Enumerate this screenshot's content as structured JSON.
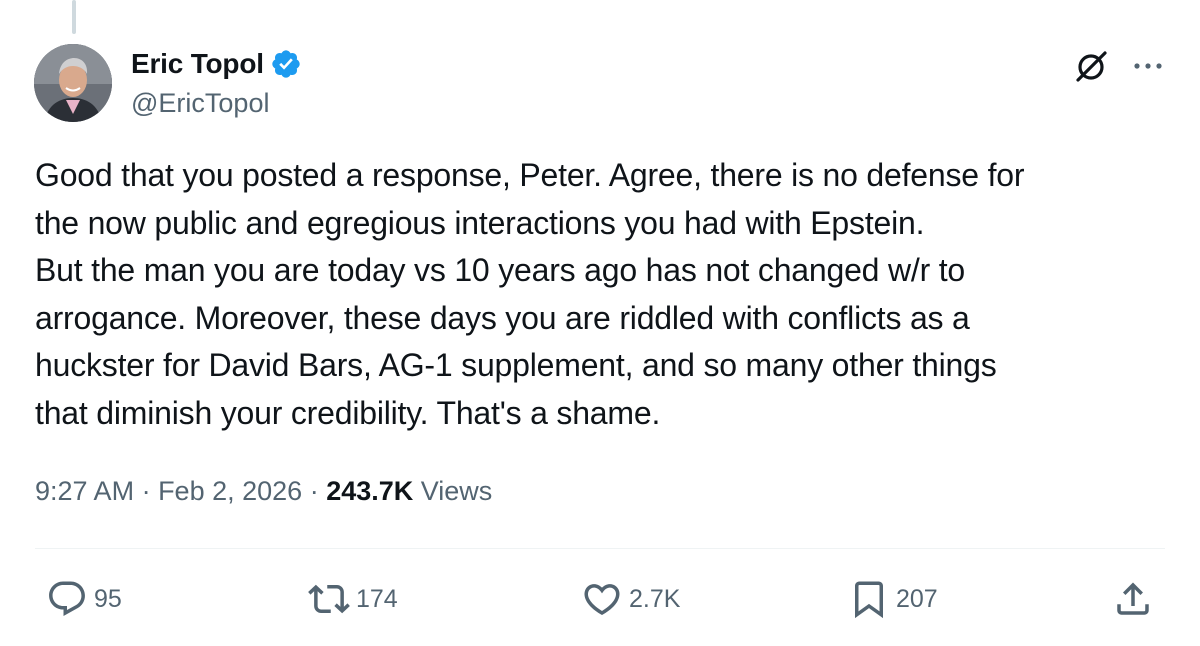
{
  "author": {
    "display_name": "Eric Topol",
    "handle": "@EricTopol",
    "verified": true
  },
  "tweet": {
    "text": "Good that you posted a response, Peter. Agree, there is no defense for\nthe now public and egregious interactions you had with Epstein.\nBut the man you are today vs 10 years ago has not changed w/r to\narrogance. Moreover, these days you are riddled with conflicts as a\nhuckster for David Bars, AG-1 supplement, and so many other things\nthat diminish your credibility. That's a shame."
  },
  "meta": {
    "time": "9:27 AM",
    "separator": " · ",
    "date": "Feb 2, 2026",
    "views_count": "243.7K",
    "views_label": " Views"
  },
  "actions": {
    "replies": "95",
    "reposts": "174",
    "likes": "2.7K",
    "bookmarks": "207"
  },
  "colors": {
    "text_primary": "#0f1419",
    "text_secondary": "#536471",
    "verified_blue": "#1d9bf0",
    "divider": "#eff3f4"
  },
  "icons": [
    "verified-badge-icon",
    "grok-icon",
    "more-icon",
    "reply-icon",
    "repost-icon",
    "like-icon",
    "bookmark-icon",
    "share-icon"
  ]
}
